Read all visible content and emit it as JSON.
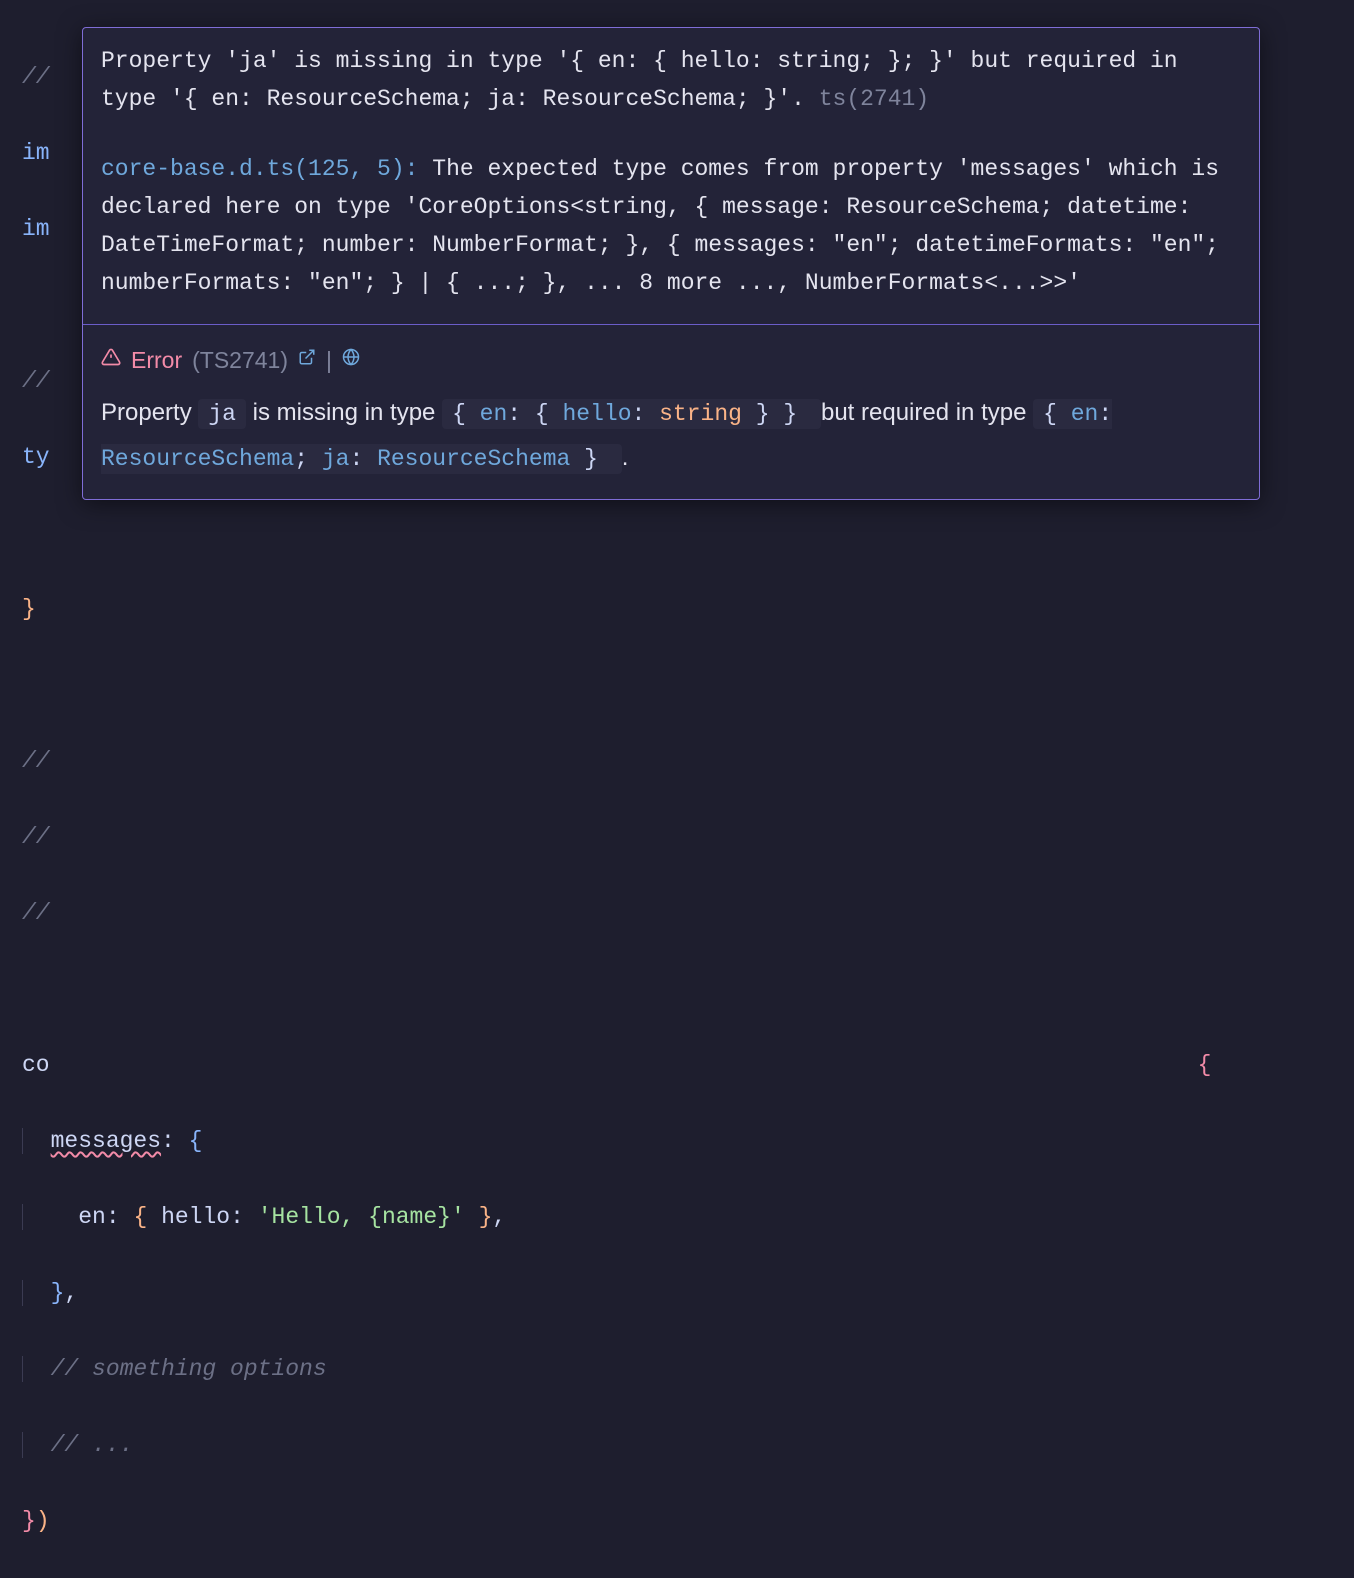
{
  "code": {
    "line1_comment": "//",
    "line2_im": "im",
    "line3_im": "im",
    "line5_comment": "//",
    "line6_ty": "ty",
    "line8_brace": "}",
    "line10_comment": "//",
    "line11_comment": "//",
    "line12_comment": "//",
    "line14_co": "co",
    "line14_brace_open": "{",
    "line15_messages": "messages",
    "line15_colon": ":",
    "line15_brace": "{",
    "line16_en": "en",
    "line16_colon": ":",
    "line16_brace_open": "{",
    "line16_hello": "hello",
    "line16_colon2": ":",
    "line16_string": "'Hello, {name}'",
    "line16_brace_close": "}",
    "line16_comma": ",",
    "line17_brace": "}",
    "line17_comma": ",",
    "line18_comment": "// something options",
    "line19_comment": "// ...",
    "line20_brace": "}",
    "line20_paren": ")"
  },
  "popup": {
    "msg1_a": "Property 'ja' is missing in type '{ en: { hello: string; }; }' but required in type '{ en: ResourceSchema; ja: ResourceSchema; }'.",
    "msg1_code": " ts(2741)",
    "msg2_link": "core-base.d.ts(125, 5): ",
    "msg2_text": "The expected type comes from property 'messages' which is declared here on type 'CoreOptions<string, { message: ResourceSchema; datetime: DateTimeFormat; number: NumberFormat; }, { messages: \"en\"; datetimeFormats: \"en\"; numberFormats: \"en\"; } | { ...; }, ... 8 more ..., NumberFormats<...>>'",
    "err_label": "Error",
    "err_ts_code": "(TS2741)",
    "rich_prop": "Property ",
    "rich_ja": "ja",
    "rich_missing": " is missing in type ",
    "rich_type1_a": " { ",
    "rich_type1_en": "en",
    "rich_type1_b": ": { ",
    "rich_type1_hello": "hello",
    "rich_type1_c": ": ",
    "rich_type1_string": "string",
    "rich_type1_d": " } } ",
    "rich_but": " but required in type ",
    "rich_type2_a": " { ",
    "rich_type2_en": "en",
    "rich_type2_b": ": ",
    "rich_type2_rs1": "ResourceSchema",
    "rich_type2_c": "; ",
    "rich_type2_ja": "ja",
    "rich_type2_d": ": ",
    "rich_type2_rs2": "ResourceSchema",
    "rich_type2_e": " } ",
    "rich_dot": "."
  }
}
